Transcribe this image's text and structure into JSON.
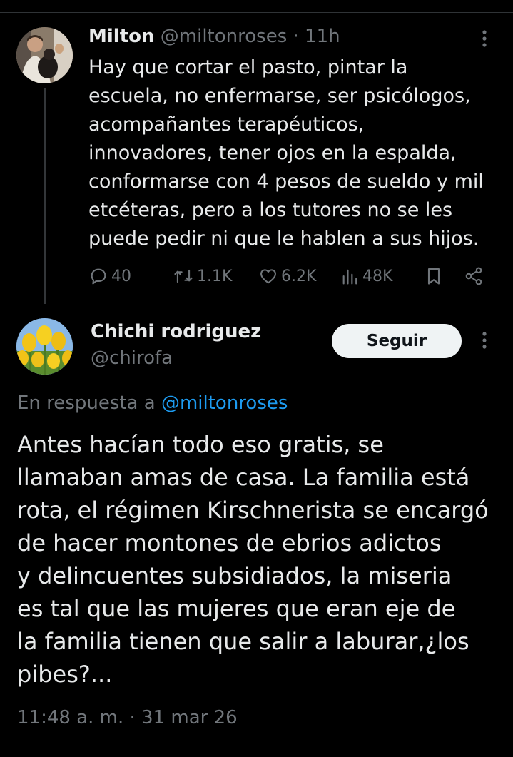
{
  "parent_tweet": {
    "display_name": "Milton",
    "handle": "@miltonroses",
    "separator": "·",
    "time": "11h",
    "text": "Hay que cortar el pasto, pintar la\nescuela, no enfermarse, ser psicólogos,\nacompañantes terapéuticos,\ninnovadores, tener ojos en la espalda,\nconformarse con 4 pesos de sueldo y mil\netcéteras, pero a los tutores no se les\npuede pedir ni que le hablen a sus hijos.",
    "stats": {
      "replies": "40",
      "reposts": "1.1K",
      "likes": "6.2K",
      "views": "48K"
    }
  },
  "reply_tweet": {
    "display_name": "Chichi rodriguez",
    "handle": "@chirofa",
    "follow_label": "Seguir",
    "reply_prefix": "En respuesta a",
    "reply_mention": "@miltonroses",
    "text": "Antes hacían todo eso gratis, se\nllamaban amas de casa. La familia está\nrota, el régimen Kirschnerista se encargó\nde hacer montones de ebrios adictos\ny delincuentes subsidiados, la miseria\nes tal que las mujeres que eran eje de\nla familia tienen que salir a laburar,¿los\npibes?...",
    "timestamp": "11:48 a. m. · 31 mar 26"
  },
  "icons": {
    "reply": "speech-bubble-icon",
    "repost": "repost-arrows-icon",
    "like": "heart-icon",
    "views": "bar-chart-icon",
    "bookmark": "bookmark-icon",
    "share": "share-icon",
    "more": "more-vertical-icon"
  },
  "colors": {
    "background": "#000000",
    "text": "#e7e9ea",
    "secondary_text": "#71767b",
    "link": "#1d9bf0",
    "button_bg": "#eff3f4"
  }
}
